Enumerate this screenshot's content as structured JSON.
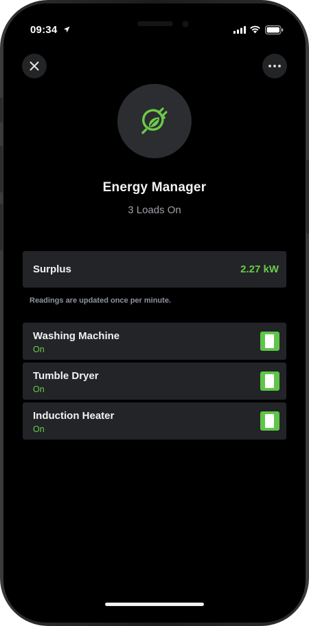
{
  "status_bar": {
    "time": "09:34",
    "location_icon": "location-arrow-icon",
    "signal_icon": "cellular-signal-icon",
    "wifi_icon": "wifi-icon",
    "battery_icon": "battery-icon"
  },
  "header": {
    "close_icon": "close-icon",
    "more_icon": "more-icon"
  },
  "hero": {
    "icon": "eco-plug-icon",
    "title": "Energy Manager",
    "subtitle": "3 Loads On"
  },
  "surplus": {
    "label": "Surplus",
    "value": "2.27 kW"
  },
  "note": "Readings are updated once per minute.",
  "loads": [
    {
      "name": "Washing Machine",
      "state": "On",
      "enabled": true
    },
    {
      "name": "Tumble Dryer",
      "state": "On",
      "enabled": true
    },
    {
      "name": "Induction Heater",
      "state": "On",
      "enabled": true
    }
  ],
  "colors": {
    "accent": "#6ccb49",
    "toggle": "#5fc548",
    "card": "#222427",
    "background": "#000000"
  }
}
